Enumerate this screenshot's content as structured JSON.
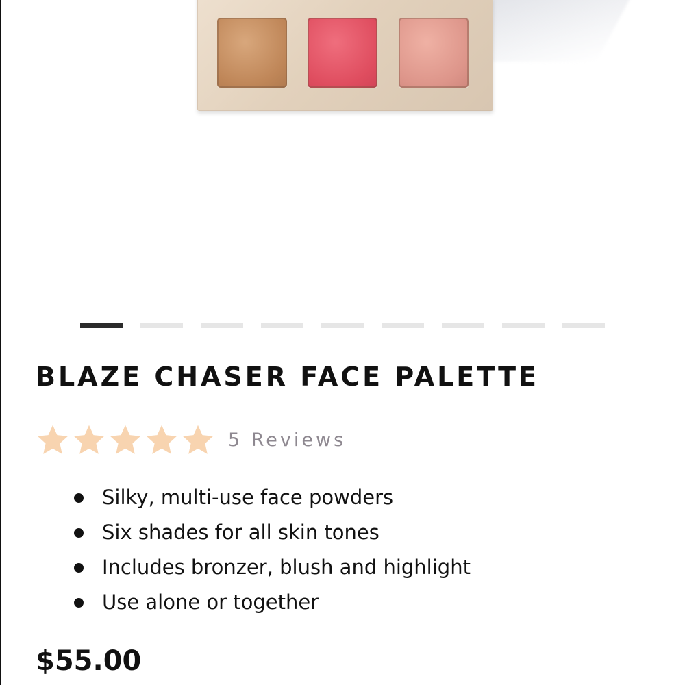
{
  "product": {
    "title": "BLAZE CHASER FACE PALETTE",
    "rating": {
      "stars": 5,
      "max_stars": 5,
      "star_color": "#f8d4b0",
      "reviews_label": "5 Reviews"
    },
    "features": [
      "Silky, multi-use face powders",
      "Six shades for all skin tones",
      "Includes bronzer, blush and highlight",
      "Use alone or together"
    ],
    "price": "$55.00"
  },
  "gallery": {
    "image_count": 9,
    "active_index": 0,
    "palette_shades": [
      "#c48c5e",
      "#e2515f",
      "#e09a8e"
    ]
  }
}
